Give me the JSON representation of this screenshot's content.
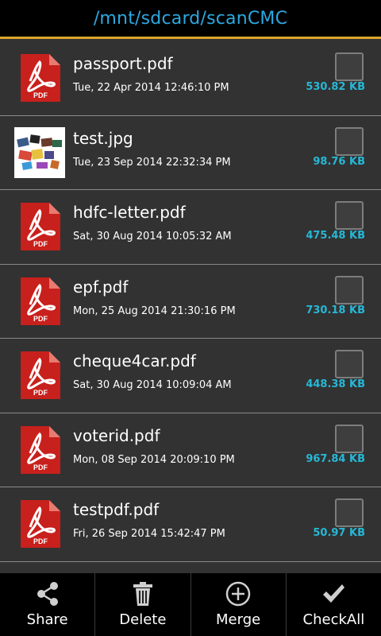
{
  "header": {
    "path": "/mnt/sdcard/scanCMC"
  },
  "files": [
    {
      "name": "passport.pdf",
      "date": "Tue, 22 Apr 2014 12:46:10 PM",
      "size": "530.82 KB",
      "type": "pdf"
    },
    {
      "name": "test.jpg",
      "date": "Tue, 23 Sep 2014 22:32:34 PM",
      "size": "98.76 KB",
      "type": "image"
    },
    {
      "name": "hdfc-letter.pdf",
      "date": "Sat, 30 Aug 2014 10:05:32 AM",
      "size": "475.48 KB",
      "type": "pdf"
    },
    {
      "name": "epf.pdf",
      "date": "Mon, 25 Aug 2014 21:30:16 PM",
      "size": "730.18 KB",
      "type": "pdf"
    },
    {
      "name": "cheque4car.pdf",
      "date": "Sat, 30 Aug 2014 10:09:04 AM",
      "size": "448.38 KB",
      "type": "pdf"
    },
    {
      "name": "voterid.pdf",
      "date": "Mon, 08 Sep 2014 20:09:10 PM",
      "size": "967.84 KB",
      "type": "pdf"
    },
    {
      "name": "testpdf.pdf",
      "date": "Fri, 26 Sep 2014 15:42:47 PM",
      "size": "50.97 KB",
      "type": "pdf"
    }
  ],
  "pdf_badge": "PDF",
  "toolbar": {
    "share_label": "Share",
    "delete_label": "Delete",
    "merge_label": "Merge",
    "checkall_label": "CheckAll",
    "share_icon": "share-icon",
    "delete_icon": "trash-icon",
    "merge_icon": "plus-circle-icon",
    "checkall_icon": "checkmark-icon"
  },
  "colors": {
    "accent": "#d9a52b",
    "path_text": "#2aa9e0",
    "size_text": "#26b8d6",
    "pdf_red": "#c8201c"
  }
}
